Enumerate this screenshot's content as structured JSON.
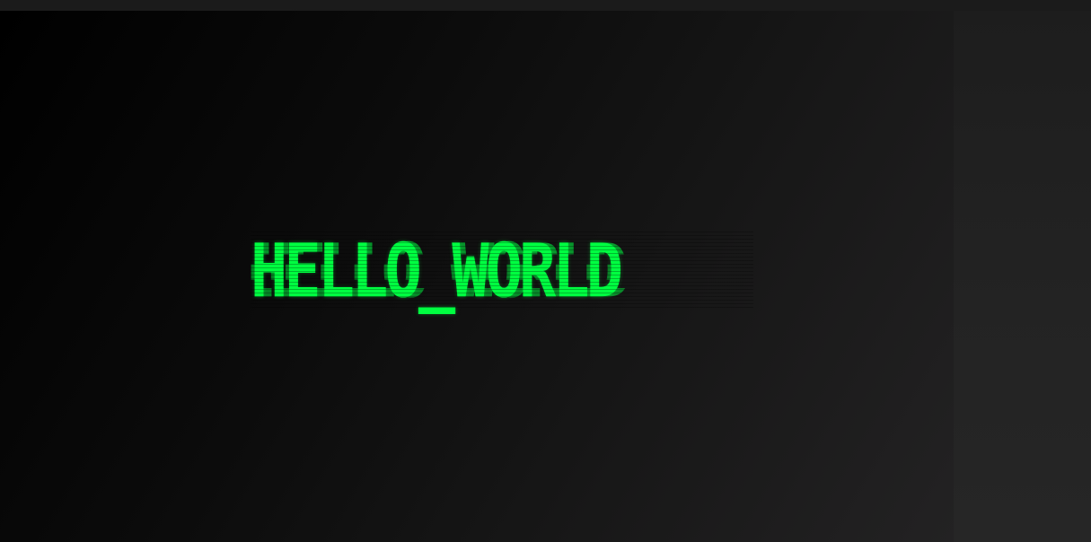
{
  "display": {
    "text": "HELLO_WORLD"
  },
  "colors": {
    "accent": "#00ff41",
    "stage_dark": "#000000",
    "stage_light": "#232223",
    "side_panel": "#1d1d1d"
  }
}
